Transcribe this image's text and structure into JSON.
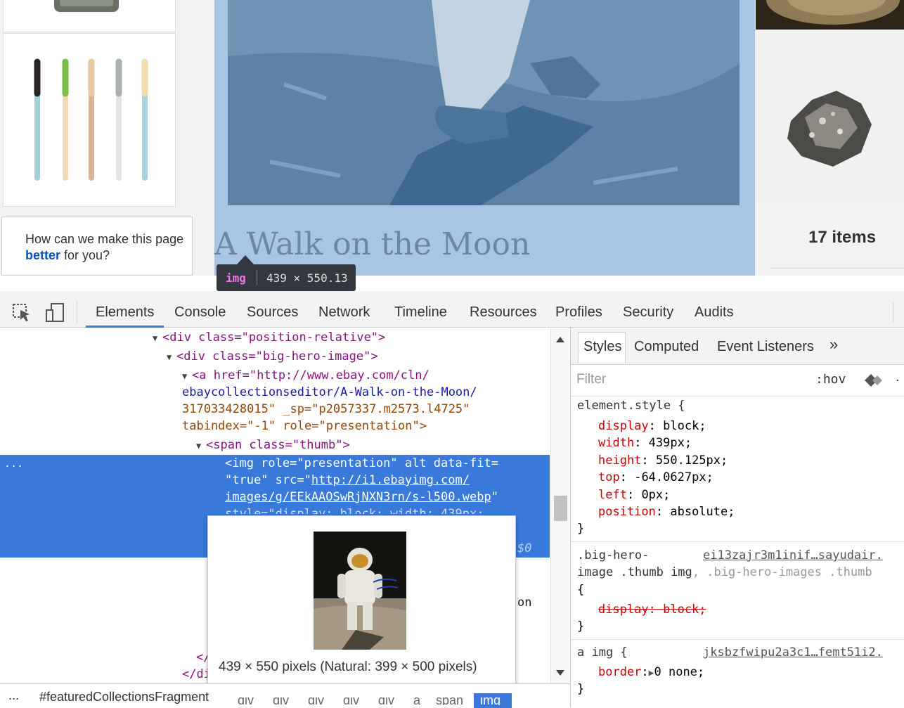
{
  "page": {
    "collection_title": "A Walk on the Moon",
    "feedback_prefix": "How can we make this page ",
    "feedback_bold": "better",
    "feedback_suffix": " for you?",
    "items_count": "17 items",
    "inspector_tag": "img",
    "inspector_size": "439 × 550.13"
  },
  "devtools": {
    "tabs": [
      "Elements",
      "Console",
      "Sources",
      "Network",
      "Timeline",
      "Resources",
      "Profiles",
      "Security",
      "Audits"
    ],
    "sidebar_tabs": [
      "Styles",
      "Computed",
      "Event Listeners"
    ],
    "more_tabs": "»",
    "filter_placeholder": "Filter",
    "hov": ":hov",
    "tree": {
      "l1": "<div class=\"position-relative\">",
      "l2": "<div class=\"big-hero-image\">",
      "l3a": "<a href=\"http://www.ebay.com/cln/",
      "l3b": "ebaycollectionseditor/A-Walk-on-the-Moon/",
      "l3c": "317033428015\" _sp=\"p2057337.m2573.l4725\"",
      "l3d": "tabindex=\"-1\" role=\"presentation\">",
      "l4": "<span class=\"thumb\">",
      "l5a": "<img role=\"presentation\" alt data-fit=",
      "l5b": "\"true\" src=\"",
      "l5b_link": "http://i1.ebayimg.com/",
      "l5c_link": "images/g/EEkAAOSwRjNXN3rn/s-l500.webp",
      "l5c_end": "\"",
      "l5d": "style=\"display: block; width: 439px;",
      "l5e": "$0",
      "frag_on": "on",
      "close1": "</",
      "close2": "</di"
    },
    "ellipsis": "...",
    "breadcrumb": "#featuredCollectionsFragment",
    "crumbs": [
      "div",
      "div",
      "div",
      "div",
      "div",
      "a",
      "span",
      "img"
    ],
    "preview_caption": "439 × 550 pixels (Natural: 399 × 500 pixels)",
    "styles": {
      "element_style": "element.style {",
      "props": [
        {
          "k": "display",
          "v": "block;"
        },
        {
          "k": "width",
          "v": "439px;"
        },
        {
          "k": "height",
          "v": "550.125px;"
        },
        {
          "k": "top",
          "v": "-64.0627px;"
        },
        {
          "k": "left",
          "v": "0px;"
        },
        {
          "k": "position",
          "v": "absolute;"
        }
      ],
      "close": "}",
      "rule2_sel1": ".big-hero-",
      "rule2_src": "ei13zajr3m1inif…sayudair.",
      "rule2_sel2": "image .thumb img",
      "rule2_sel2b": ", .big-hero-images .thumb",
      "open": "{",
      "rule2_prop": "display: block;",
      "rule3_sel": "a img {",
      "rule3_src": "jksbzfwipu2a3c1…femt51i2.",
      "rule3_k": "border",
      "rule3_v": "0 none;"
    }
  },
  "colors": {
    "highlight": "#3879d9",
    "overlay": "rgba(111,168,220,0.66)",
    "link": "#0654ba"
  }
}
